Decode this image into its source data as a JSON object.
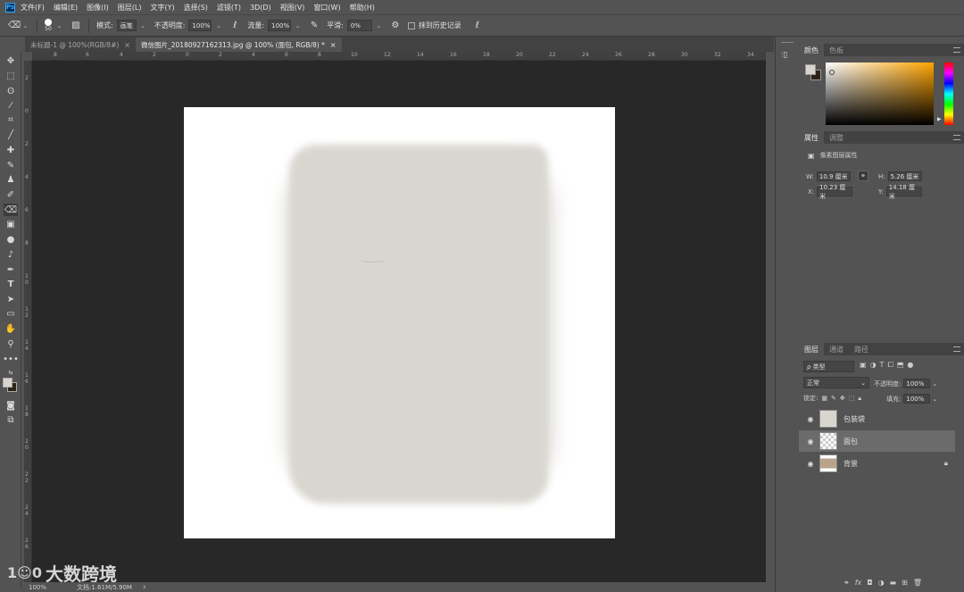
{
  "menubar": {
    "logo": "Ps",
    "items": [
      "文件(F)",
      "编辑(E)",
      "图像(I)",
      "图层(L)",
      "文字(Y)",
      "选择(S)",
      "滤镜(T)",
      "3D(D)",
      "视图(V)",
      "窗口(W)",
      "帮助(H)"
    ]
  },
  "options": {
    "brush_size": "50",
    "mode_label": "模式:",
    "mode_value": "画笔",
    "opacity_label": "不透明度:",
    "opacity_value": "100%",
    "flow_label": "流量:",
    "flow_value": "100%",
    "smooth_label": "平滑:",
    "smooth_value": "0%",
    "history_label": "抹到历史记录"
  },
  "tabs": [
    {
      "label": "未标题-1 @ 100%(RGB/8#)",
      "close": "×"
    },
    {
      "label": "微信图片_20180927162313.jpg @ 100% (面包, RGB/8) *",
      "close": "×"
    }
  ],
  "ruler": {
    "top": [
      "8",
      "6",
      "4",
      "2",
      "0",
      "2",
      "4",
      "6",
      "8",
      "10",
      "12",
      "14",
      "16",
      "18",
      "20",
      "22",
      "24",
      "26",
      "28",
      "30",
      "32",
      "34"
    ],
    "left": [
      "2",
      "0",
      "2",
      "4",
      "6",
      "8",
      "1 0",
      "1 2",
      "1 4",
      "1 6",
      "1 8",
      "2 0",
      "2 2",
      "2 4",
      "2 6"
    ]
  },
  "status": {
    "zoom": "100%",
    "doc": "文档:1.61M/5.90M",
    "arrow": "›"
  },
  "watermark": {
    "logo": "1☺0",
    "text": "大数跨境"
  },
  "color_panel": {
    "tabs": [
      "颜色",
      "色板"
    ],
    "fg_color": "#d8d5cf",
    "bg_color": "#2d2417"
  },
  "props_panel": {
    "tabs": [
      "属性",
      "调整"
    ],
    "title": "像素图层属性",
    "w_label": "W:",
    "w_value": "10.9 厘米",
    "h_label": "H:",
    "h_value": "5.26 厘米",
    "x_label": "X:",
    "x_value": "10.23 厘米",
    "y_label": "Y:",
    "y_value": "14.18 厘米"
  },
  "layers_panel": {
    "tabs": [
      "图层",
      "通道",
      "路径"
    ],
    "filter_label": "ρ 类型",
    "blend_mode": "正常",
    "opacity_label": "不透明度:",
    "opacity_value": "100%",
    "lock_label": "锁定:",
    "fill_label": "填充:",
    "fill_value": "100%",
    "layers": [
      {
        "name": "包装袋"
      },
      {
        "name": "面包"
      },
      {
        "name": "背景"
      }
    ],
    "bottom_fx": "fx"
  }
}
